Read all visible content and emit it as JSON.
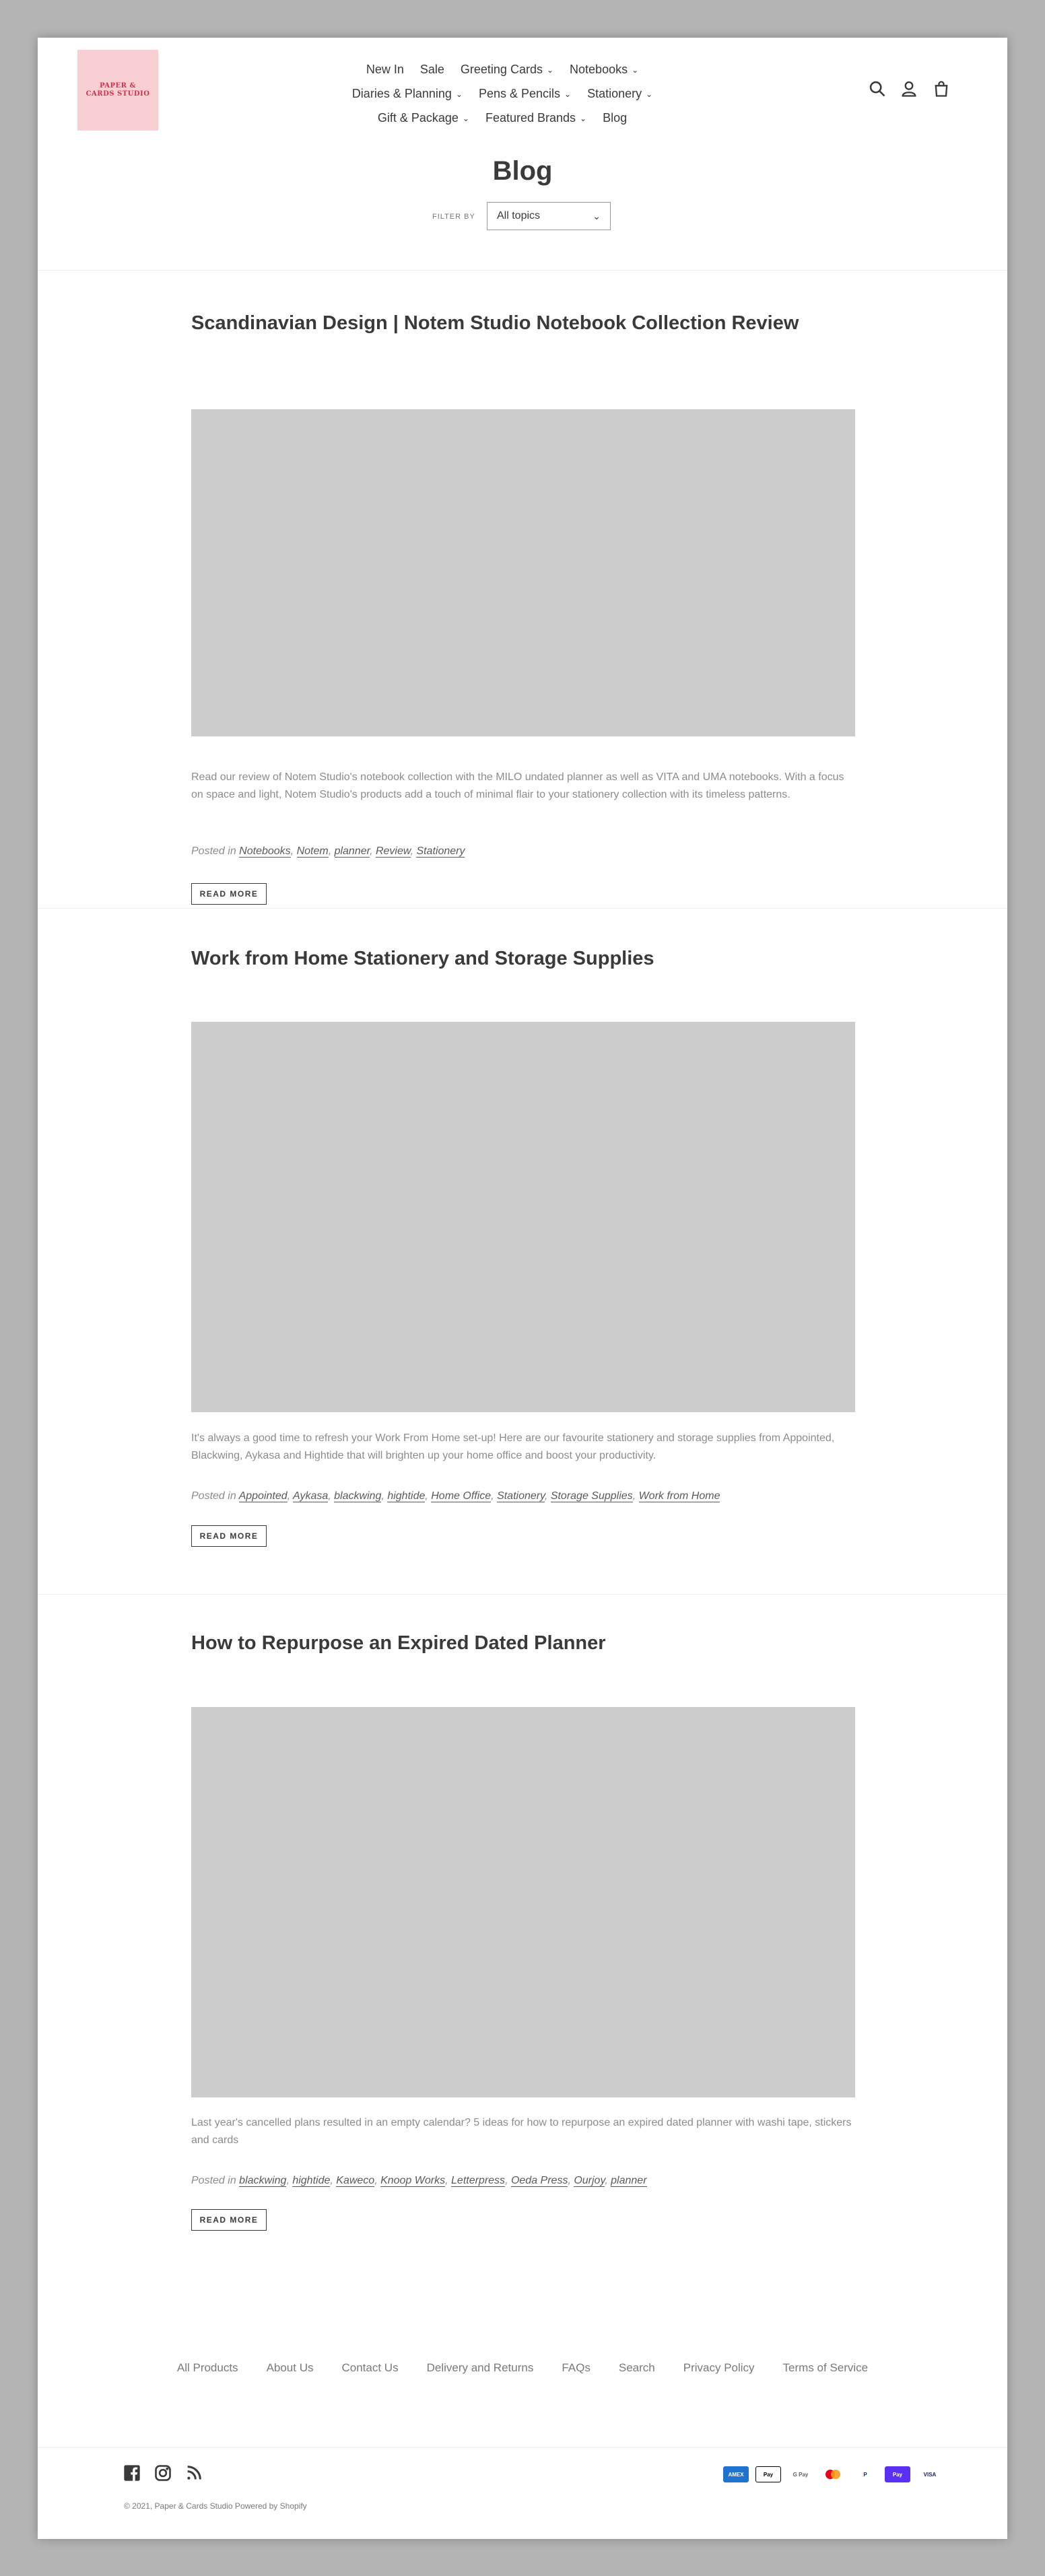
{
  "header": {
    "logo_text": "PAPER & CARDS STUDIO",
    "nav_rows": [
      [
        {
          "label": "New In",
          "dropdown": false
        },
        {
          "label": "Sale",
          "dropdown": false
        },
        {
          "label": "Greeting Cards",
          "dropdown": true
        },
        {
          "label": "Notebooks",
          "dropdown": true
        }
      ],
      [
        {
          "label": "Diaries & Planning",
          "dropdown": true
        },
        {
          "label": "Pens & Pencils",
          "dropdown": true
        },
        {
          "label": "Stationery",
          "dropdown": true
        }
      ],
      [
        {
          "label": "Gift & Package",
          "dropdown": true
        },
        {
          "label": "Featured Brands",
          "dropdown": true
        },
        {
          "label": "Blog",
          "dropdown": false
        }
      ]
    ],
    "icons": [
      "search-icon",
      "account-icon",
      "cart-icon"
    ]
  },
  "blog": {
    "title": "Blog",
    "filter_label": "FILTER BY",
    "filter_value": "All topics"
  },
  "articles": [
    {
      "title": "Scandinavian Design | Notem Studio Notebook Collection Review",
      "excerpt": "Read our review of Notem Studio's notebook collection with the MILO undated planner as well as VITA and UMA notebooks. With a focus on space and light, Notem Studio's products add a touch of minimal flair to your stationery collection with its timeless patterns.",
      "posted_in": "Posted in",
      "tags": [
        "Notebooks",
        "Notem",
        "planner",
        "Review",
        "Stationery"
      ],
      "read_more": "READ MORE"
    },
    {
      "title": "Work from Home Stationery and Storage Supplies",
      "excerpt": "It's always a good time to refresh your Work From Home set-up! Here are our favourite stationery and storage supplies from Appointed, Blackwing, Aykasa and Hightide that will brighten up your home office and boost your productivity.",
      "posted_in": "Posted in",
      "tags": [
        "Appointed",
        "Aykasa",
        "blackwing",
        "hightide",
        "Home Office",
        "Stationery",
        "Storage Supplies",
        "Work from Home"
      ],
      "read_more": "READ MORE"
    },
    {
      "title": "How to Repurpose an Expired Dated Planner",
      "excerpt": "Last year's cancelled plans resulted in an empty calendar? 5 ideas for how to repurpose an expired dated planner with washi tape, stickers and cards",
      "posted_in": "Posted in",
      "tags": [
        "blackwing",
        "hightide",
        "Kaweco",
        "Knoop Works",
        "Letterpress",
        "Oeda Press",
        "Ourjoy",
        "planner"
      ],
      "read_more": "READ MORE"
    }
  ],
  "footer": {
    "links": [
      "All Products",
      "About Us",
      "Contact Us",
      "Delivery and Returns",
      "FAQs",
      "Search",
      "Privacy Policy",
      "Terms of Service"
    ],
    "social": [
      "facebook-icon",
      "instagram-icon",
      "rss-icon"
    ],
    "payments": [
      {
        "label": "AMEX",
        "bg": "#1f72cd",
        "fg": "#ffffff",
        "border": "#1f72cd"
      },
      {
        "label": "Pay",
        "bg": "#ffffff",
        "fg": "#000000",
        "border": "#000000"
      },
      {
        "label": "G Pay",
        "bg": "#ffffff",
        "fg": "#5f6368",
        "border": "#ffffff"
      },
      {
        "label": "",
        "bg": "#ffffff",
        "fg": "#000000",
        "border": "#ffffff"
      },
      {
        "label": "P",
        "bg": "#ffffff",
        "fg": "#003087",
        "border": "#ffffff"
      },
      {
        "label": "Pay",
        "bg": "#5a31f4",
        "fg": "#ffffff",
        "border": "#5a31f4"
      },
      {
        "label": "VISA",
        "bg": "#ffffff",
        "fg": "#1a1f71",
        "border": "#ffffff"
      }
    ],
    "copyright": "© 2021, Paper & Cards Studio Powered by Shopify"
  }
}
